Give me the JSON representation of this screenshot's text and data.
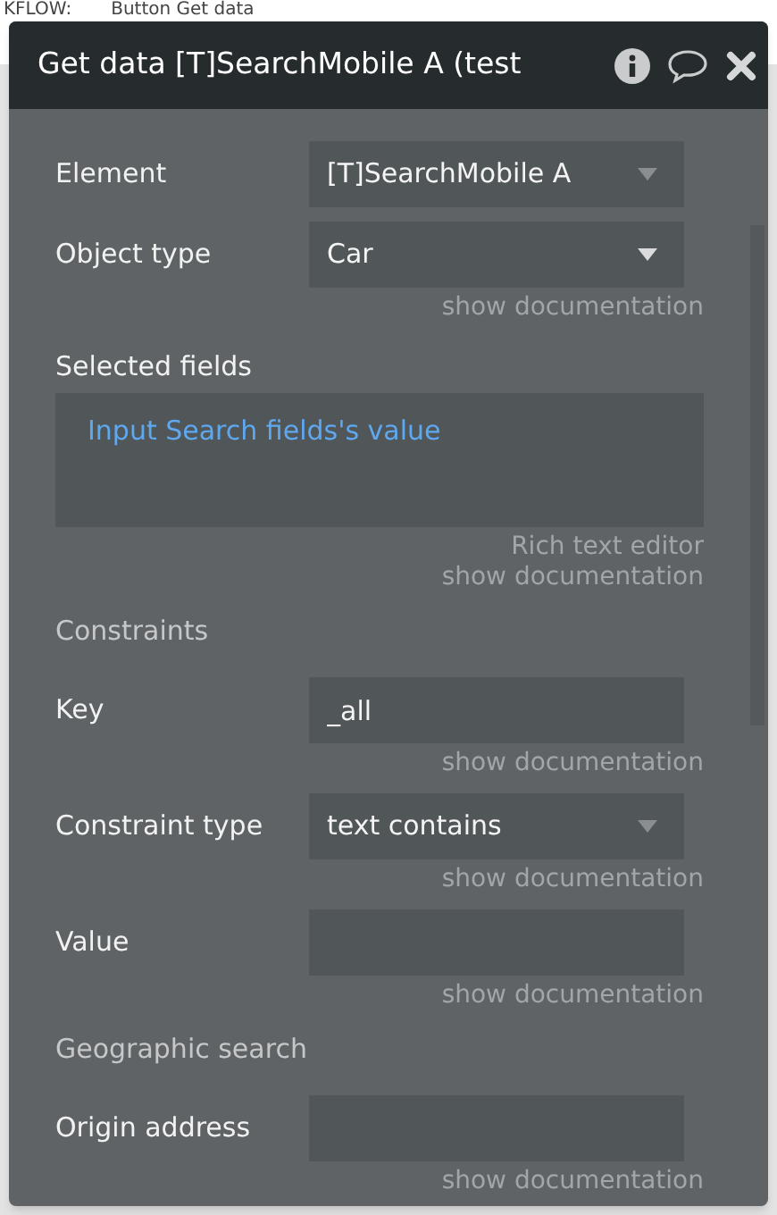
{
  "background": {
    "texts": [
      "KFLOW:",
      "Button Get data"
    ]
  },
  "panel": {
    "title": "Get data [T]SearchMobile A (test"
  },
  "rows": [
    {
      "kind": "dropdown",
      "label": "Element",
      "value": "[T]SearchMobile A",
      "dim_caret": true
    },
    {
      "kind": "dropdown",
      "label": "Object type",
      "value": "Car",
      "dim_caret": false,
      "notes": [
        "show documentation"
      ]
    },
    {
      "kind": "textarea",
      "label": "Selected fields",
      "value": "Input Search fields's value",
      "notes": [
        "Rich text editor",
        "show documentation"
      ]
    },
    {
      "kind": "section",
      "label": "Constraints"
    },
    {
      "kind": "text",
      "label": "Key",
      "value": "_all",
      "notes": [
        "show documentation"
      ]
    },
    {
      "kind": "dropdown",
      "label": "Constraint type",
      "value": "text contains",
      "dim_caret": true,
      "notes": [
        "show documentation"
      ]
    },
    {
      "kind": "text",
      "label": "Value",
      "notes": [
        "show documentation"
      ]
    },
    {
      "kind": "section",
      "label": "Geographic search"
    },
    {
      "kind": "text",
      "label": "Origin address",
      "notes": [
        "show documentation"
      ]
    }
  ]
}
